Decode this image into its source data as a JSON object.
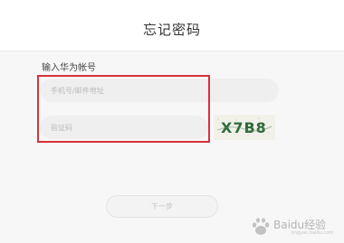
{
  "header": {
    "title": "忘记密码"
  },
  "form": {
    "section_label": "输入华为帐号",
    "phone_placeholder": "手机号/邮件地址",
    "code_placeholder": "验证码",
    "captcha_text": "X7B8",
    "next_label": "下一步"
  },
  "watermark": {
    "text": "Baidu经验",
    "subtext": "jingyan.baidu.com"
  },
  "colors": {
    "highlight": "#d6323a",
    "captcha_ink": "#2f6a3a",
    "background": "#f7f7f7"
  }
}
